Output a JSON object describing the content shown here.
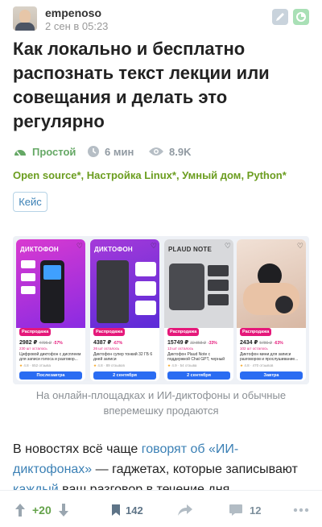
{
  "header": {
    "author": "empenoso",
    "date": "2 сен в 05:23"
  },
  "article": {
    "title": "Как локально и бесплатно распознать текст лекции или совещания и делать это регулярно",
    "level": "Простой",
    "read_time": "6 мин",
    "views": "8.9K",
    "hubs": [
      "Open source*",
      "Настройка Linux*",
      "Умный дом",
      "Python*"
    ],
    "badge": "Кейс"
  },
  "figure": {
    "caption": "На онлайн-площадках и ИИ-диктофоны и обычные вперемешку продаются",
    "cards": [
      {
        "pic_label": "ДИКТОФОН",
        "promo": "Распродажа",
        "price": "2982 ₽",
        "old_price": "4796 ₽",
        "discount": "-57%",
        "stock": "230 шт осталось",
        "name": "Цифровой диктофон с дисплеем для записи голоса и разговор...",
        "rating": "4.8",
        "reviews": "652 отзыва",
        "button": "Послезавтра"
      },
      {
        "pic_label": "ДИКТОФОН",
        "promo": "Распродажа",
        "price": "4387 ₽",
        "old_price": "",
        "discount": "-67%",
        "stock": "26 шт осталось",
        "name": "Диктофон супер тонкий 32 ГБ 6 дней записи",
        "rating": "4.8",
        "reviews": "89 отзывов",
        "button": "2 сентября"
      },
      {
        "pic_label": "PLAUD NOTE",
        "promo": "Распродажа",
        "price": "15749 ₽",
        "old_price": "22 858 ₽",
        "discount": "-33%",
        "stock": "13 шт осталось",
        "name": "Диктофон Plaud Note с поддержкой Chat GPT, черный",
        "rating": "4.9",
        "reviews": "54 отзыва",
        "button": "2 сентября"
      },
      {
        "pic_label": "",
        "promo": "Распродажа",
        "price": "2434 ₽",
        "old_price": "5780 ₽",
        "discount": "-63%",
        "stock": "102 шт осталось",
        "name": "Диктофон мини для записи разговоров и прослушивание...",
        "rating": "4.8",
        "reviews": "470 отзывов",
        "button": "Завтра"
      }
    ]
  },
  "paragraph": {
    "text1": "В новостях всё чаще ",
    "link1": "говорят об «ИИ-диктофонах»",
    "text2": " — гаджетах, которые записывают ",
    "link2": "каждый",
    "text3": " ваш разговор в течение дня."
  },
  "bottom_bar": {
    "score": "+20",
    "bookmarks": "142",
    "comments": "12"
  },
  "colors": {
    "accent_green": "#65a865",
    "hub_green": "#6b9d1f",
    "link_blue": "#3b80b5",
    "promo_pink": "#e5187a",
    "button_blue": "#2a6cf2"
  }
}
